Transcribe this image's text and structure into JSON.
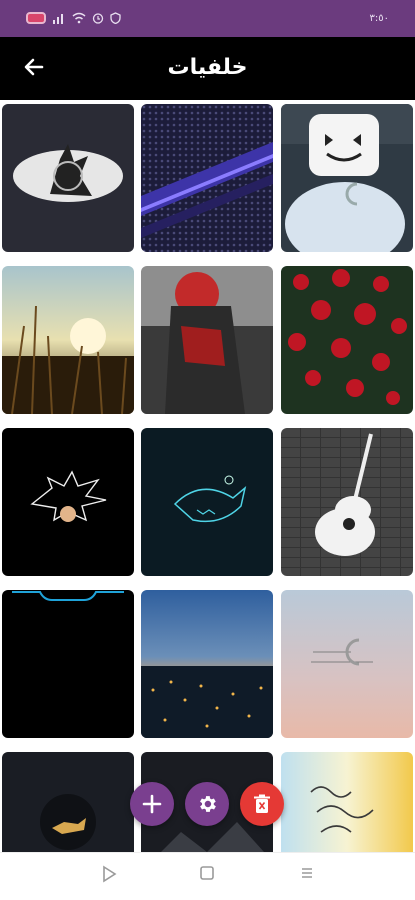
{
  "status_bar": {
    "left_icons": [
      "notification-icon",
      "signal-icon",
      "wifi-icon",
      "alarm-icon",
      "shield-icon"
    ],
    "time": "٣:٥٠"
  },
  "app_bar": {
    "title": "خلفيات",
    "back_icon": "arrow-left-icon"
  },
  "wallpapers": [
    {
      "name": "wallpaper-anime-moon"
    },
    {
      "name": "wallpaper-purple-grille"
    },
    {
      "name": "wallpaper-marshmello"
    },
    {
      "name": "wallpaper-wheat-sunset"
    },
    {
      "name": "wallpaper-red-hoodie"
    },
    {
      "name": "wallpaper-red-roses"
    },
    {
      "name": "wallpaper-goku-dark"
    },
    {
      "name": "wallpaper-neon-shark"
    },
    {
      "name": "wallpaper-guitar"
    },
    {
      "name": "wallpaper-black-notch"
    },
    {
      "name": "wallpaper-city-night"
    },
    {
      "name": "wallpaper-pastel-sky"
    },
    {
      "name": "wallpaper-deer-dark"
    },
    {
      "name": "wallpaper-dark-mountain"
    },
    {
      "name": "wallpaper-arabic-calligraphy"
    }
  ],
  "fab": {
    "add_icon": "plus-icon",
    "settings_icon": "gear-icon",
    "delete_icon": "trash-icon"
  },
  "nav_bar": {
    "back_icon": "triangle-back-icon",
    "home_icon": "square-home-icon",
    "recents_icon": "menu-lines-icon"
  },
  "colors": {
    "status_bar": "#6b3b7e",
    "app_bar": "#000000",
    "fab_purple": "#7a3f8f",
    "fab_red": "#e53935"
  }
}
